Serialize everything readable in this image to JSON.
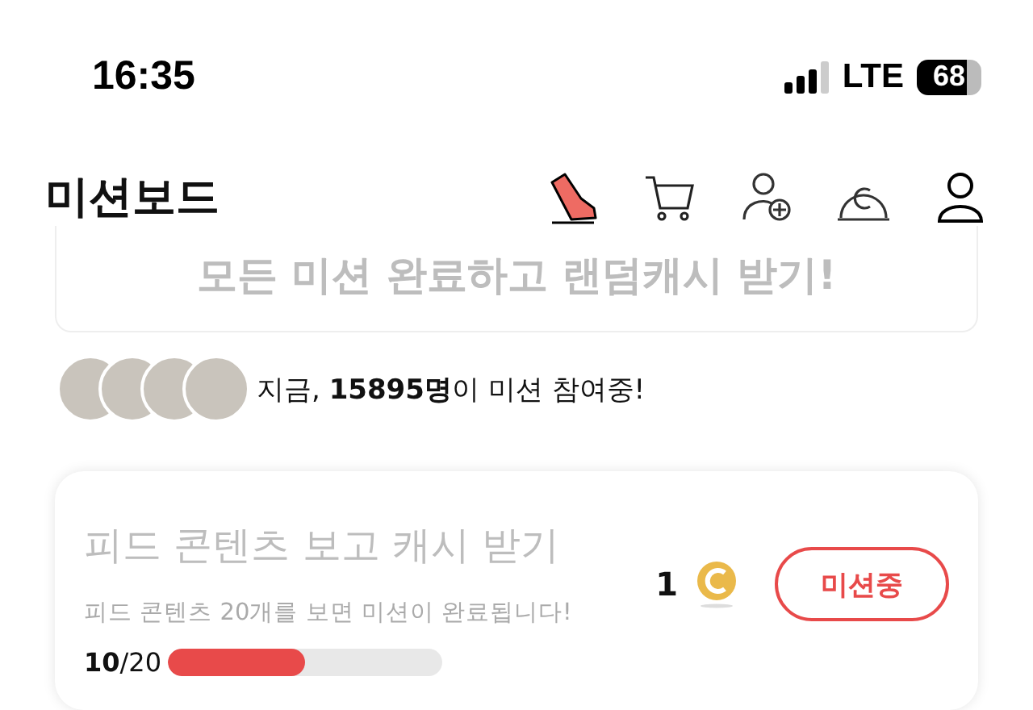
{
  "status_bar": {
    "time": "16:35",
    "network": "LTE",
    "battery": "68"
  },
  "header": {
    "title": "미션보드"
  },
  "banner": {
    "text": "모든 미션 완료하고 랜덤캐시 받기!"
  },
  "participants": {
    "avatars": [
      {
        "kind": "photo"
      },
      {
        "kind": "photo"
      },
      {
        "kind": "photo"
      },
      {
        "kind": "photo"
      }
    ],
    "text": "지금, **15895명**이 미션 참여중!"
  },
  "missions": [
    {
      "title": "피드 콘텐츠 보고 캐시 받기",
      "description": "피드 콘텐츠 20개를 보면 미션이 완료됩니다!",
      "progress": "**10**/20",
      "level": 0.5,
      "reward": "1",
      "button": "미션중"
    }
  ]
}
